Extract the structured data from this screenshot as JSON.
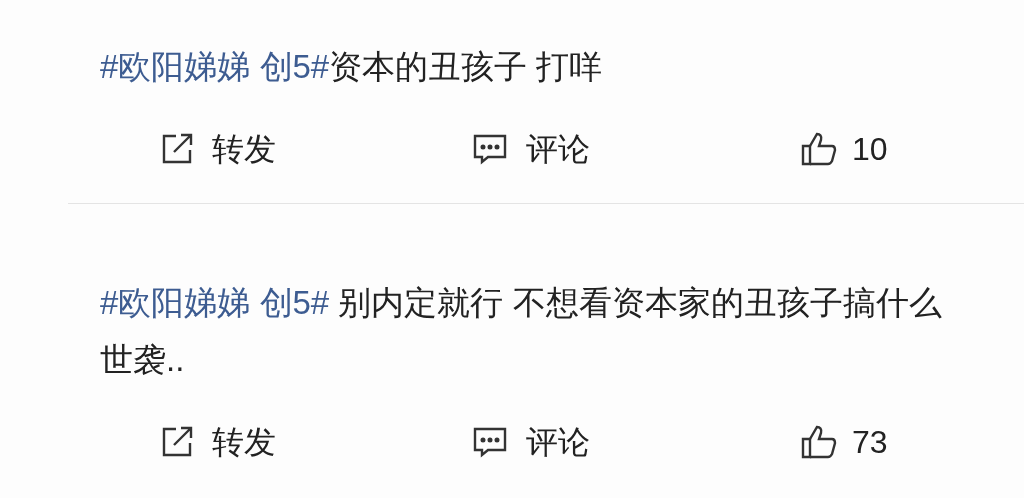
{
  "posts": [
    {
      "hashtag": "#欧阳娣娣 创5#",
      "text": "资本的丑孩子 打咩",
      "actions": {
        "share": "转发",
        "comment": "评论",
        "likes": "10"
      }
    },
    {
      "hashtag": "#欧阳娣娣 创5#",
      "text": " 别内定就行 不想看资本家的丑孩子搞什么世袭..",
      "actions": {
        "share": "转发",
        "comment": "评论",
        "likes": "73"
      }
    }
  ]
}
